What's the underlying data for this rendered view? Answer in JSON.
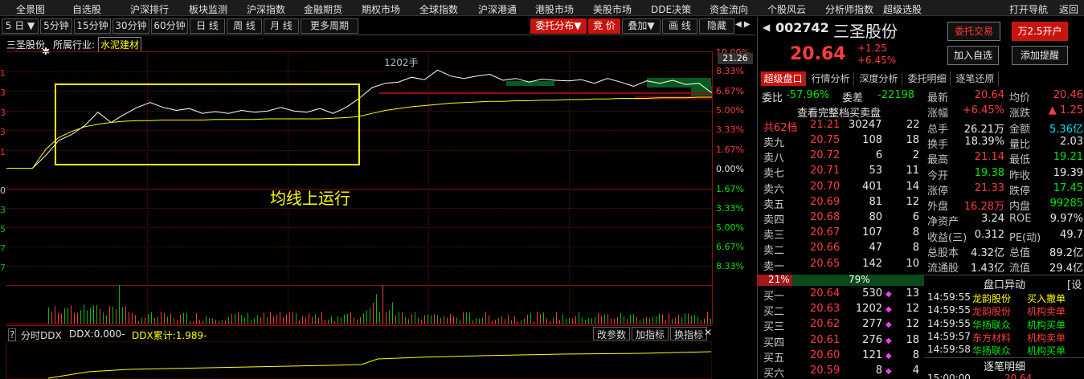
{
  "menu": [
    "全景图",
    "自选股",
    "沪深排行",
    "板块监测",
    "沪深指数",
    "金融期货",
    "期权市场",
    "全球指数",
    "沪深港通",
    "港股市场",
    "美股市场",
    "DDE决策",
    "资金流向",
    "个股风云",
    "分析师指数",
    "超级选股",
    "打开导航",
    "返回"
  ],
  "toolbar": {
    "period_select": "5 日",
    "buttons": [
      "5分钟",
      "15分钟",
      "30分钟",
      "60分钟",
      "日 线",
      "周 线",
      "月 线",
      "更多周期"
    ],
    "right_buttons": [
      "委托分布",
      "竞 价",
      "叠加",
      "画 线",
      "隐藏"
    ],
    "nav_arrows": "◀ ▶"
  },
  "chart_header": {
    "stock": "三圣股份",
    "industry_label": "所属行业:",
    "industry": "水泥建材",
    "annotation_volume": "1202手",
    "annotation_text": "均线上运行",
    "price_tag": "21.26"
  },
  "y_axis_right": [
    "10.00%",
    "8.33%",
    "6.67%",
    "5.00%",
    "3.33%",
    "1.67%",
    "0.00%",
    "1.67%",
    "3.33%",
    "5.00%",
    "6.67%",
    "8.33%"
  ],
  "y_axis_left": [
    "1",
    "1",
    "3",
    "3",
    "3",
    "1",
    "1",
    "0",
    "3",
    "5",
    "7",
    "7"
  ],
  "ddx": {
    "panel_label": "分时DDX",
    "ddx_value": "DDX:0.000-",
    "ddx_cum": "DDX累计:1.989-",
    "buttons": [
      "改参数",
      "加指标",
      "换指标"
    ]
  },
  "chart_data": {
    "type": "line",
    "prev_close": 19.39,
    "price_ylim": [
      17.45,
      21.33
    ],
    "series": [
      {
        "values": [
          19.39,
          19.39,
          19.39,
          19.6,
          19.85,
          19.95,
          20.1,
          20.32,
          20.15,
          20.28,
          20.4,
          20.48,
          20.4,
          20.35,
          20.38,
          20.3,
          20.33,
          20.3,
          20.35,
          20.32,
          20.34,
          20.4,
          20.34,
          20.32,
          20.38,
          20.3,
          20.4,
          20.55,
          20.73,
          20.8,
          20.82,
          20.9,
          20.86,
          21.02,
          20.92,
          20.88,
          20.92,
          20.95,
          20.85,
          20.88,
          20.82,
          20.87,
          20.85,
          20.84,
          20.86,
          20.8,
          20.88,
          20.82,
          20.75,
          20.84,
          20.8,
          20.85,
          20.78,
          20.8,
          20.64
        ]
      },
      {
        "values": [
          19.39,
          19.39,
          19.39,
          19.7,
          19.9,
          20.0,
          20.08,
          20.12,
          20.15,
          20.17,
          20.18,
          20.18,
          20.19,
          20.19,
          20.19,
          20.19,
          20.2,
          20.2,
          20.2,
          20.2,
          20.21,
          20.21,
          20.21,
          20.21,
          20.21,
          20.22,
          20.23,
          20.25,
          20.3,
          20.35,
          20.38,
          20.41,
          20.43,
          20.45,
          20.47,
          20.48,
          20.49,
          20.5,
          20.5,
          20.51,
          20.51,
          20.52,
          20.52,
          20.53,
          20.53,
          20.54,
          20.54,
          20.55,
          20.55,
          20.55,
          20.56,
          20.56,
          20.56,
          20.57,
          20.57
        ]
      }
    ]
  },
  "quote": {
    "code": "002742",
    "name": "三圣股份",
    "price": "20.64",
    "change": "+1.25",
    "change_pct": "+6.45%",
    "btn_trade": "委托交易",
    "btn_open": "万2.5开户",
    "btn_add": "加入自选",
    "btn_alert": "添加提醒"
  },
  "tabs": [
    "超级盘口",
    "行情分析",
    "深度分析",
    "委托明细",
    "逐笔还原"
  ],
  "weibi": {
    "label": "委比",
    "value": "-57.96%",
    "label2": "委差",
    "value2": "-22198",
    "full_book": "查看完整档买卖盘"
  },
  "book_top": {
    "label": "共62档",
    "price": "21.21",
    "vol": "30247",
    "num": "22"
  },
  "sells": [
    {
      "label": "卖九",
      "price": "20.75",
      "vol": "108",
      "num": "18"
    },
    {
      "label": "卖八",
      "price": "20.72",
      "vol": "6",
      "num": "2"
    },
    {
      "label": "卖七",
      "price": "20.71",
      "vol": "53",
      "num": "11"
    },
    {
      "label": "卖六",
      "price": "20.70",
      "vol": "401",
      "num": "14"
    },
    {
      "label": "卖五",
      "price": "20.69",
      "vol": "81",
      "num": "12"
    },
    {
      "label": "卖四",
      "price": "20.68",
      "vol": "80",
      "num": "6"
    },
    {
      "label": "卖三",
      "price": "20.67",
      "vol": "107",
      "num": "8"
    },
    {
      "label": "卖二",
      "price": "20.66",
      "vol": "47",
      "num": "8"
    },
    {
      "label": "卖一",
      "price": "20.65",
      "vol": "142",
      "num": "10"
    }
  ],
  "ratio": {
    "left": "21%",
    "right": "79%"
  },
  "buys": [
    {
      "label": "买一",
      "price": "20.64",
      "vol": "530",
      "num": "13"
    },
    {
      "label": "买二",
      "price": "20.63",
      "vol": "1202",
      "num": "12"
    },
    {
      "label": "买三",
      "price": "20.62",
      "vol": "277",
      "num": "12"
    },
    {
      "label": "买四",
      "price": "20.61",
      "vol": "276",
      "num": "18"
    },
    {
      "label": "买五",
      "price": "20.60",
      "vol": "121",
      "num": "8"
    },
    {
      "label": "买六",
      "price": "20.59",
      "vol": "8",
      "num": "4"
    }
  ],
  "stats": [
    {
      "l1": "最新",
      "v1": "20.64",
      "c1": "red",
      "l2": "均价",
      "v2": "20.46",
      "c2": "red"
    },
    {
      "l1": "涨幅",
      "v1": "+6.45%",
      "c1": "red",
      "l2": "涨跌",
      "v2": "▲ 1.25",
      "c2": "red"
    },
    {
      "l1": "总手",
      "v1": "26.21万",
      "c1": "white",
      "l2": "金额",
      "v2": "5.36亿",
      "c2": "cyan"
    },
    {
      "l1": "换手",
      "v1": "18.39%",
      "c1": "white",
      "l2": "量比",
      "v2": "2.03",
      "c2": "white"
    },
    {
      "l1": "最高",
      "v1": "21.14",
      "c1": "red",
      "l2": "最低",
      "v2": "19.21",
      "c2": "green"
    },
    {
      "l1": "今开",
      "v1": "19.38",
      "c1": "green",
      "l2": "昨收",
      "v2": "19.39",
      "c2": "white"
    },
    {
      "l1": "涨停",
      "v1": "21.33",
      "c1": "red",
      "l2": "跌停",
      "v2": "17.45",
      "c2": "green"
    },
    {
      "l1": "外盘",
      "v1": "16.28万",
      "c1": "red",
      "l2": "内盘",
      "v2": "99285",
      "c2": "green"
    },
    {
      "l1": "净资产",
      "v1": "3.24",
      "c1": "white",
      "l2": "ROE",
      "v2": "9.97%",
      "c2": "white"
    },
    {
      "l1": "收益(三)",
      "v1": "0.312",
      "c1": "white",
      "l2": "PE(动)",
      "v2": "49.7",
      "c2": "white"
    },
    {
      "l1": "总股本",
      "v1": "4.32亿",
      "c1": "white",
      "l2": "总值",
      "v2": "89.2亿",
      "c2": "white"
    },
    {
      "l1": "流通股",
      "v1": "1.43亿",
      "c1": "white",
      "l2": "流值",
      "v2": "29.4亿",
      "c2": "white"
    }
  ],
  "pankou": {
    "title": "盘口异动",
    "settings": "[设",
    "rows": [
      {
        "time": "14:59:55",
        "name": "龙韵股份",
        "action": "买入撤单",
        "nc": "yellow",
        "ac": "yellow"
      },
      {
        "time": "14:59:55",
        "name": "龙韵股份",
        "action": "机构卖单",
        "nc": "red",
        "ac": "red"
      },
      {
        "time": "14:59:55",
        "name": "华扬联众",
        "action": "机构买单",
        "nc": "green",
        "ac": "green"
      },
      {
        "time": "14:59:57",
        "name": "东方材料",
        "action": "机构卖单",
        "nc": "red",
        "ac": "red"
      },
      {
        "time": "14:59:58",
        "name": "华扬联众",
        "action": "机构买单",
        "nc": "green",
        "ac": "green"
      }
    ]
  },
  "zhubi": {
    "title": "逐笔明细",
    "time": "15:00:00",
    "price": "20.64"
  },
  "colors": {
    "price_line": "#ffffff",
    "avg_line": "#ffff00",
    "up": "#ff3c3c",
    "down": "#00e600",
    "highlight_box": "#ffff00"
  }
}
